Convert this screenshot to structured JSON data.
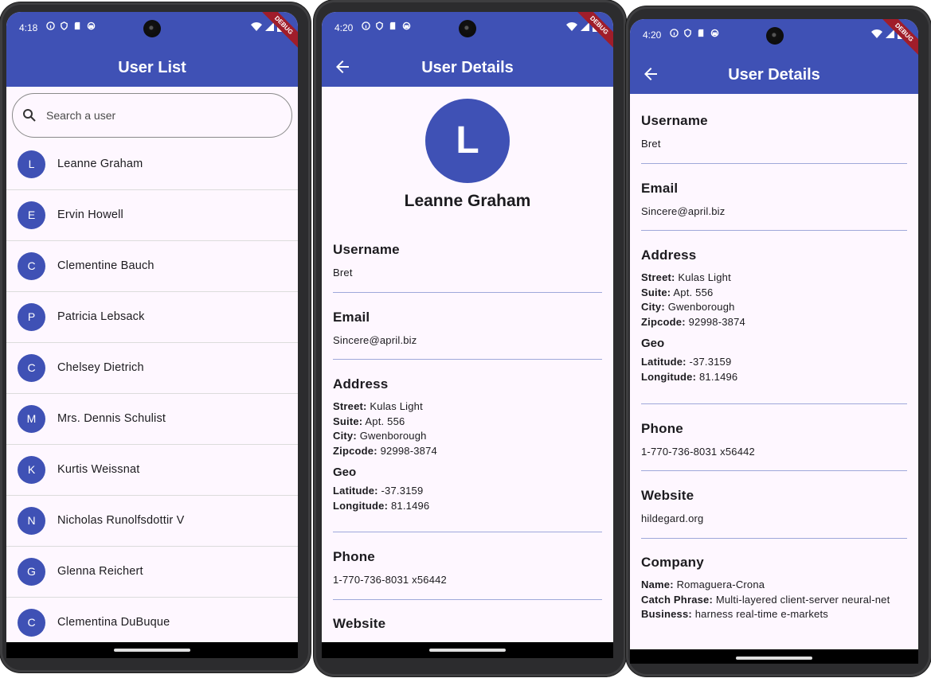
{
  "screen1": {
    "time": "4:18",
    "title": "User List",
    "debug": "DEBUG",
    "search_placeholder": "Search a user",
    "users": [
      {
        "initial": "L",
        "name": "Leanne Graham"
      },
      {
        "initial": "E",
        "name": "Ervin Howell"
      },
      {
        "initial": "C",
        "name": "Clementine Bauch"
      },
      {
        "initial": "P",
        "name": "Patricia Lebsack"
      },
      {
        "initial": "C",
        "name": "Chelsey Dietrich"
      },
      {
        "initial": "M",
        "name": "Mrs. Dennis Schulist"
      },
      {
        "initial": "K",
        "name": "Kurtis Weissnat"
      },
      {
        "initial": "N",
        "name": "Nicholas Runolfsdottir V"
      },
      {
        "initial": "G",
        "name": "Glenna Reichert"
      },
      {
        "initial": "C",
        "name": "Clementina DuBuque"
      }
    ]
  },
  "screen2": {
    "time": "4:20",
    "title": "User Details",
    "debug": "DEBUG",
    "avatar_initial": "L",
    "name": "Leanne Graham",
    "username_label": "Username",
    "username": "Bret",
    "email_label": "Email",
    "email": "Sincere@april.biz",
    "address_label": "Address",
    "street_label": "Street:",
    "street": "Kulas Light",
    "suite_label": "Suite:",
    "suite": "Apt. 556",
    "city_label": "City:",
    "city": "Gwenborough",
    "zipcode_label": "Zipcode:",
    "zipcode": "92998-3874",
    "geo_label": "Geo",
    "lat_label": "Latitude:",
    "lat": "-37.3159",
    "lng_label": "Longitude:",
    "lng": "81.1496",
    "phone_label": "Phone",
    "phone": "1-770-736-8031 x56442",
    "website_label": "Website"
  },
  "screen3": {
    "time": "4:20",
    "title": "User Details",
    "debug": "DEBUG",
    "username_label": "Username",
    "username": "Bret",
    "email_label": "Email",
    "email": "Sincere@april.biz",
    "address_label": "Address",
    "street_label": "Street:",
    "street": "Kulas Light",
    "suite_label": "Suite:",
    "suite": "Apt. 556",
    "city_label": "City:",
    "city": "Gwenborough",
    "zipcode_label": "Zipcode:",
    "zipcode": "92998-3874",
    "geo_label": "Geo",
    "lat_label": "Latitude:",
    "lat": "-37.3159",
    "lng_label": "Longitude:",
    "lng": "81.1496",
    "phone_label": "Phone",
    "phone": "1-770-736-8031 x56442",
    "website_label": "Website",
    "website": "hildegard.org",
    "company_label": "Company",
    "company_name_label": "Name:",
    "company_name": "Romaguera-Crona",
    "catch_label": "Catch Phrase:",
    "catch": "Multi-layered client-server neural-net",
    "bs_label": "Business:",
    "bs": "harness real-time e-markets"
  },
  "colors": {
    "primary": "#3f51b5",
    "background": "#fef7ff",
    "divider": "#9fa8da"
  },
  "icons": [
    "search-icon",
    "back-arrow-icon",
    "wifi-icon",
    "signal-icon",
    "battery-icon"
  ]
}
